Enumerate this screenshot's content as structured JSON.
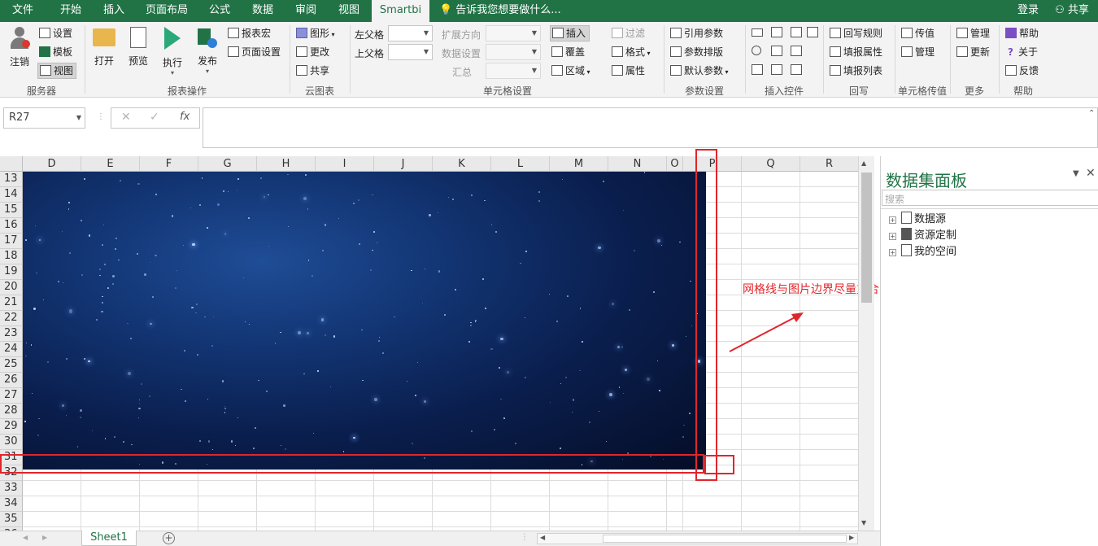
{
  "tabs": [
    "文件",
    "开始",
    "插入",
    "页面布局",
    "公式",
    "数据",
    "审阅",
    "视图",
    "Smartbi"
  ],
  "tell_me": "告诉我您想要做什么...",
  "login": "登录",
  "share": "共享",
  "ribbon": {
    "server": {
      "logout": "注销",
      "settings": "设置",
      "template": "模板",
      "view": "视图",
      "label": "服务器"
    },
    "report": {
      "open": "打开",
      "preview": "预览",
      "execute": "执行",
      "publish": "发布",
      "macro": "报表宏",
      "page_setup": "页面设置",
      "label": "报表操作"
    },
    "cloud": {
      "chart": "图形",
      "change": "更改",
      "share": "共享",
      "label": "云图表"
    },
    "parent": {
      "left": "左父格",
      "top": "上父格"
    },
    "cell": {
      "expand": "扩展方向",
      "dataset": "数据设置",
      "summary": "汇总",
      "insert": "插入",
      "cover": "覆盖",
      "area": "区域",
      "label": "单元格设置"
    },
    "format": {
      "filter": "过滤",
      "format": "格式",
      "attr": "属性"
    },
    "param": {
      "ref": "引用参数",
      "layout": "参数排版",
      "default": "默认参数",
      "label": "参数设置"
    },
    "controls": {
      "label": "插入控件"
    },
    "writeback": {
      "rule": "回写规则",
      "fill_attr": "填报属性",
      "fill_list": "填报列表",
      "label": "回写"
    },
    "cellval": {
      "pass": "传值",
      "manage": "管理",
      "label": "单元格传值"
    },
    "more": {
      "manage": "管理",
      "update": "更新",
      "label": "更多"
    },
    "help": {
      "help": "帮助",
      "about": "关于",
      "feedback": "反馈",
      "label": "帮助"
    }
  },
  "name_box": "R27",
  "columns": [
    "D",
    "E",
    "F",
    "G",
    "H",
    "I",
    "J",
    "K",
    "L",
    "M",
    "N",
    "O",
    "P",
    "Q",
    "R"
  ],
  "rows": [
    "13",
    "14",
    "15",
    "16",
    "17",
    "18",
    "19",
    "20",
    "21",
    "22",
    "23",
    "24",
    "25",
    "26",
    "27",
    "28",
    "29",
    "30",
    "31",
    "32",
    "33",
    "34",
    "35",
    "36"
  ],
  "annotation": "网格线与图片边界尽量重合，不要留出一部分空白单元格",
  "annotation_color": "#e0262b",
  "sheet_tab": "Sheet1",
  "panel": {
    "title": "数据集面板",
    "search_placeholder": "搜索",
    "tree": [
      "数据源",
      "资源定制",
      "我的空间"
    ]
  },
  "colors": {
    "excel_green": "#217346",
    "smartbi_green": "#217346"
  }
}
